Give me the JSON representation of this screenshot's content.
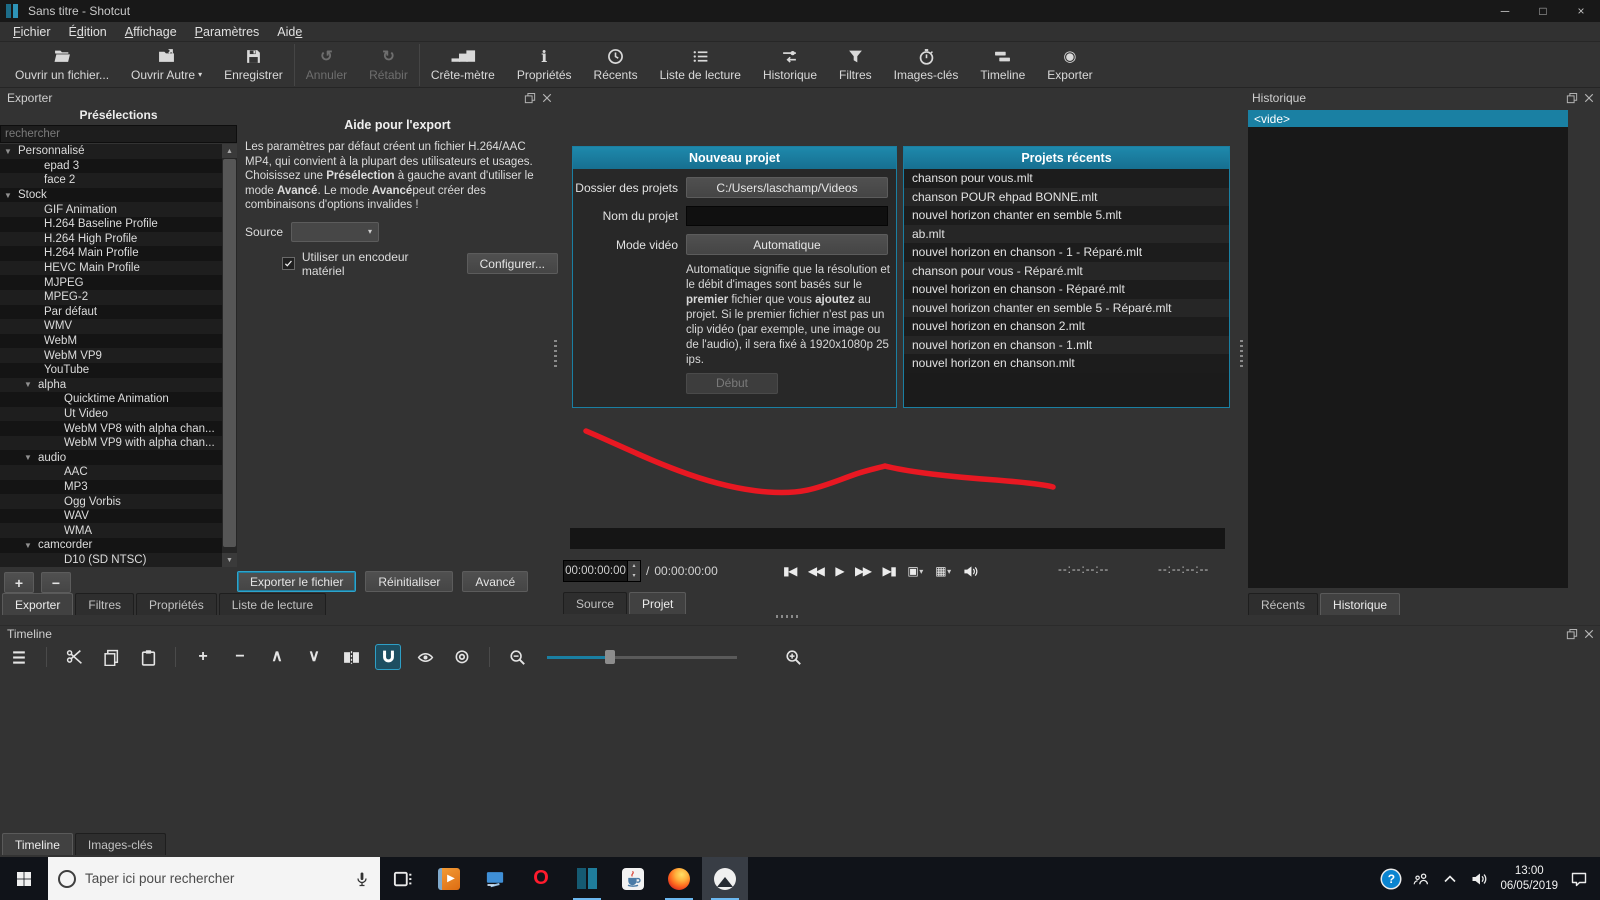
{
  "window": {
    "title": "Sans titre - Shotcut"
  },
  "menu": {
    "items": [
      {
        "id": "fichier",
        "pre": "",
        "u": "F",
        "post": "ichier"
      },
      {
        "id": "edition",
        "pre": "É",
        "u": "d",
        "post": "ition"
      },
      {
        "id": "affichage",
        "pre": "",
        "u": "A",
        "post": "ffichage"
      },
      {
        "id": "parametres",
        "pre": "",
        "u": "P",
        "post": "aramètres"
      },
      {
        "id": "aide",
        "pre": "Aid",
        "u": "e",
        "post": ""
      }
    ]
  },
  "toolbar": {
    "items": [
      {
        "id": "open-file",
        "icon": "folder-open",
        "label": "Ouvrir un fichier..."
      },
      {
        "id": "open-other",
        "icon": "folder-other",
        "label": "Ouvrir Autre",
        "caret": true
      },
      {
        "id": "save",
        "icon": "save",
        "label": "Enregistrer"
      },
      {
        "id": "undo",
        "icon": "undo",
        "label": "Annuler",
        "disabled": true,
        "sep": true
      },
      {
        "id": "redo",
        "icon": "redo",
        "label": "Rétabir",
        "disabled": true
      },
      {
        "id": "peak-meter",
        "icon": "peak-meter",
        "label": "Crête-mètre",
        "sep": true
      },
      {
        "id": "properties",
        "icon": "info",
        "label": "Propriétés"
      },
      {
        "id": "recent",
        "icon": "clock",
        "label": "Récents"
      },
      {
        "id": "playlist",
        "icon": "list",
        "label": "Liste de lecture"
      },
      {
        "id": "history",
        "icon": "history",
        "label": "Historique"
      },
      {
        "id": "filters",
        "icon": "funnel",
        "label": "Filtres"
      },
      {
        "id": "keyframes",
        "icon": "stopwatch",
        "label": "Images-clés"
      },
      {
        "id": "timeline",
        "icon": "timeline",
        "label": "Timeline"
      },
      {
        "id": "export",
        "icon": "export",
        "label": "Exporter"
      }
    ]
  },
  "export_panel": {
    "title": "Exporter",
    "presets_header": "Présélections",
    "search_placeholder": "rechercher",
    "tree": [
      {
        "label": "Personnalisé",
        "level": 0,
        "group": true
      },
      {
        "label": "epad 3",
        "level": 1
      },
      {
        "label": "face 2",
        "level": 1
      },
      {
        "label": "Stock",
        "level": 0,
        "group": true
      },
      {
        "label": "GIF Animation",
        "level": 1
      },
      {
        "label": "H.264 Baseline Profile",
        "level": 1
      },
      {
        "label": "H.264 High Profile",
        "level": 1
      },
      {
        "label": "H.264 Main Profile",
        "level": 1
      },
      {
        "label": "HEVC Main Profile",
        "level": 1
      },
      {
        "label": "MJPEG",
        "level": 1
      },
      {
        "label": "MPEG-2",
        "level": 1
      },
      {
        "label": "Par défaut",
        "level": 1
      },
      {
        "label": "WMV",
        "level": 1
      },
      {
        "label": "WebM",
        "level": 1
      },
      {
        "label": "WebM VP9",
        "level": 1
      },
      {
        "label": "YouTube",
        "level": 1
      },
      {
        "label": "alpha",
        "level": 1,
        "group": true
      },
      {
        "label": "Quicktime Animation",
        "level": 2
      },
      {
        "label": "Ut Video",
        "level": 2
      },
      {
        "label": "WebM VP8 with alpha chan...",
        "level": 2
      },
      {
        "label": "WebM VP9 with alpha chan...",
        "level": 2
      },
      {
        "label": "audio",
        "level": 1,
        "group": true
      },
      {
        "label": "AAC",
        "level": 2
      },
      {
        "label": "MP3",
        "level": 2
      },
      {
        "label": "Ogg Vorbis",
        "level": 2
      },
      {
        "label": "WAV",
        "level": 2
      },
      {
        "label": "WMA",
        "level": 2
      },
      {
        "label": "camcorder",
        "level": 1,
        "group": true
      },
      {
        "label": "D10 (SD NTSC)",
        "level": 2
      }
    ],
    "add_button": "+",
    "remove_button": "−",
    "help": {
      "title": "Aide pour l'export",
      "p1": "Les paramètres par défaut créent un fichier H.264/AAC MP4, qui convient à la plupart des utilisateurs et usages. Choisissez une ",
      "b1": "Présélection",
      "p2": " à gauche avant d'utiliser le mode ",
      "b2": "Avancé",
      "p3": ". Le mode ",
      "b3": "Avancé",
      "p4": "peut créer des combinaisons d'options invalides !"
    },
    "source_label": "Source",
    "hw_encoder_label": "Utiliser un encodeur matériel",
    "hw_encoder_checked": true,
    "configure_button": "Configurer...",
    "actions": {
      "export": "Exporter le fichier",
      "reset": "Réinitialiser",
      "advanced": "Avancé"
    },
    "tabs": [
      "Exporter",
      "Filtres",
      "Propriétés",
      "Liste de lecture"
    ]
  },
  "new_project": {
    "title": "Nouveau projet",
    "folder_label": "Dossier des projets",
    "folder_value": "C:/Users/laschamp/Videos",
    "name_label": "Nom du projet",
    "name_value": "",
    "mode_label": "Mode vidéo",
    "mode_value": "Automatique",
    "desc": {
      "p1": "Automatique signifie que la résolution et le débit d'images sont basés sur le ",
      "b1": "premier",
      "p2": " fichier que vous ",
      "b2": "ajoutez",
      "p3": " au projet. Si le premier fichier n'est pas un clip vidéo (par exemple, une image ou de l'audio), il sera fixé à 1920x1080p 25 ips."
    },
    "start_button": "Début"
  },
  "recent_projects": {
    "title": "Projets récents",
    "items": [
      "chanson pour vous.mlt",
      "chanson POUR ehpad BONNE.mlt",
      "nouvel horizon chanter en semble 5.mlt",
      "ab.mlt",
      "nouvel horizon en chanson - 1 - Réparé.mlt",
      "chanson pour vous - Réparé.mlt",
      "nouvel horizon en chanson - Réparé.mlt",
      "nouvel horizon chanter en semble 5 - Réparé.mlt",
      "nouvel horizon en chanson 2.mlt",
      "nouvel horizon en chanson - 1.mlt",
      "nouvel horizon en chanson.mlt"
    ]
  },
  "player": {
    "current_time": "00:00:00:00",
    "separator": "/",
    "total_time": "00:00:00:00",
    "in_point": "--:--:--:--",
    "out_point": "--:--:--:--",
    "transport": [
      {
        "icon": "skip-start"
      },
      {
        "icon": "rewind"
      },
      {
        "icon": "play"
      },
      {
        "icon": "fast-forward"
      },
      {
        "icon": "skip-end"
      },
      {
        "icon": "stop-fit",
        "caret": true
      },
      {
        "icon": "grid",
        "caret": true
      },
      {
        "icon": "volume"
      }
    ],
    "tabs": [
      "Source",
      "Projet"
    ]
  },
  "history_panel": {
    "title": "Historique",
    "items": [
      "<vide>"
    ],
    "tabs": [
      "Récents",
      "Historique"
    ]
  },
  "timeline_panel": {
    "title": "Timeline",
    "tools": [
      {
        "icon": "menu"
      },
      {
        "type": "sep"
      },
      {
        "icon": "cut"
      },
      {
        "icon": "copy"
      },
      {
        "icon": "paste"
      },
      {
        "type": "sep"
      },
      {
        "icon": "append"
      },
      {
        "icon": "ripple-delete"
      },
      {
        "icon": "lift"
      },
      {
        "icon": "overwrite"
      },
      {
        "icon": "split"
      },
      {
        "icon": "snap",
        "active": true
      },
      {
        "icon": "scrub"
      },
      {
        "icon": "ripple"
      },
      {
        "type": "sep"
      },
      {
        "icon": "zoom-out"
      },
      {
        "type": "slider"
      },
      {
        "icon": "zoom-in"
      }
    ],
    "tabs": [
      "Timeline",
      "Images-clés"
    ]
  },
  "taskbar": {
    "search_placeholder": "Taper ici pour rechercher",
    "apps": [
      {
        "id": "task-view"
      },
      {
        "id": "wmp"
      },
      {
        "id": "pc"
      },
      {
        "id": "opera"
      },
      {
        "id": "shotcut",
        "running": true
      },
      {
        "id": "java"
      },
      {
        "id": "firefox",
        "running": true
      },
      {
        "id": "photos",
        "running": true,
        "active": true
      }
    ],
    "clock": {
      "time": "13:00",
      "date": "06/05/2019"
    }
  },
  "annotation": {
    "type": "freehand-line",
    "color": "#e81822"
  },
  "colors": {
    "accent": "#1a7fa2",
    "panel_header": "#1b7d9e",
    "selection": "#1a80a3",
    "running_indicator": "#6cb8f0",
    "annotation_red": "#e81822"
  }
}
